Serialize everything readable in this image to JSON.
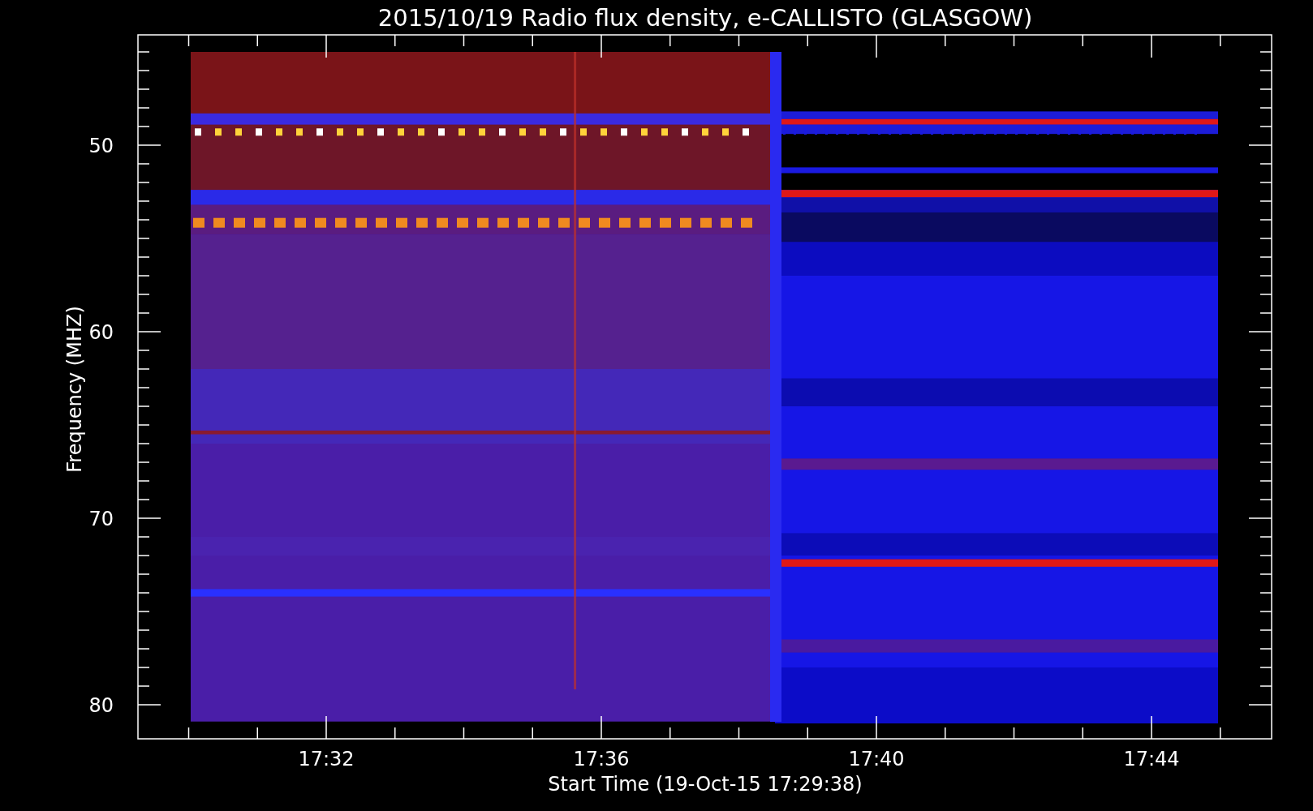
{
  "title": "2015/10/19  Radio flux density, e-CALLISTO (GLASGOW)",
  "y_axis": {
    "label": "Frequency (MHZ)",
    "ticks": [
      "50",
      "60",
      "70",
      "80"
    ]
  },
  "x_axis": {
    "label": "Start Time (19-Oct-15 17:29:38)",
    "ticks": [
      "17:32",
      "17:36",
      "17:40",
      "17:44"
    ]
  }
}
